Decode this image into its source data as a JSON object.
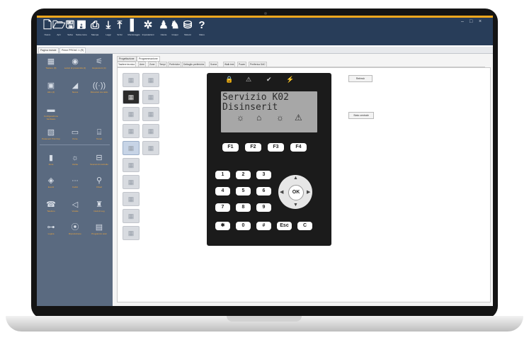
{
  "toolbar": {
    "items": [
      {
        "icon": "new-file-icon",
        "glyph": "🗋",
        "label": "Nuovo"
      },
      {
        "icon": "open-icon",
        "glyph": "🗁",
        "label": "Apri"
      },
      {
        "icon": "save-icon",
        "glyph": "🖫",
        "label": "Salva"
      },
      {
        "icon": "save-as-icon",
        "glyph": "🖪",
        "label": "Salva come"
      },
      {
        "icon": "print-icon",
        "glyph": "⎙",
        "label": "Stampa"
      },
      {
        "icon": "download-icon",
        "glyph": "⤓",
        "label": "Leggi"
      },
      {
        "icon": "upload-icon",
        "glyph": "⤒",
        "label": "Scrivi"
      },
      {
        "icon": "monitoring-icon",
        "glyph": "▌",
        "label": "Monitoraggio"
      },
      {
        "icon": "settings-icon",
        "glyph": "✲",
        "label": "Impostazioni"
      },
      {
        "icon": "user-icon",
        "glyph": "♟",
        "label": "Utente"
      },
      {
        "icon": "group-icon",
        "glyph": "♞",
        "label": "Gruppi"
      },
      {
        "icon": "database-icon",
        "glyph": "⛁",
        "label": "Sistemi"
      },
      {
        "icon": "help-icon",
        "glyph": "?",
        "label": "Manu"
      }
    ],
    "window_controls": [
      "–",
      "□",
      "×"
    ]
  },
  "doc_tabs": [
    "Pagina iniziale",
    "Prime PROAC 1 (R)"
  ],
  "sidebar": {
    "items": [
      {
        "icon": "keypad-icon",
        "glyph": "▦",
        "label": "Tastiere (8)"
      },
      {
        "icon": "wireless-icon",
        "glyph": "◉",
        "label": "Lettori di prossimità (4)"
      },
      {
        "icon": "expander-icon",
        "glyph": "⚟",
        "label": "Espansioni (4)"
      },
      {
        "icon": "power-icon",
        "glyph": "▣",
        "label": "Alim (4)"
      },
      {
        "icon": "signal-icon",
        "glyph": "◢",
        "label": "Nexus"
      },
      {
        "icon": "wireless-receiver-icon",
        "glyph": "((·))",
        "label": "Ricevitori via radio"
      },
      {
        "icon": "config-icon",
        "glyph": "▬",
        "label": "Configurazione hardware"
      },
      {
        "icon": "programming-icon",
        "glyph": "▧",
        "label": "Parametri Prim/Imp"
      },
      {
        "icon": "terminal-icon",
        "glyph": "▭",
        "label": "Porte"
      },
      {
        "icon": "timer-icon",
        "glyph": "⌸",
        "label": "Tempi"
      },
      {
        "icon": "door-icon",
        "glyph": "▮",
        "label": "Zone"
      },
      {
        "icon": "light-icon",
        "glyph": "☼",
        "label": "Uscite"
      },
      {
        "icon": "scenario-icon",
        "glyph": "⊟",
        "label": "Scenari di controllo"
      },
      {
        "icon": "event-icon",
        "glyph": "◈",
        "label": "Eventi"
      },
      {
        "icon": "code-icon",
        "glyph": "∙∙∙",
        "label": "Codici"
      },
      {
        "icon": "key-icon",
        "glyph": "⚲",
        "label": "Chiavi"
      },
      {
        "icon": "phone-icon",
        "glyph": "☎",
        "label": "Telefono"
      },
      {
        "icon": "voice-icon",
        "glyph": "◁",
        "label": "Vocale"
      },
      {
        "icon": "shield-icon",
        "glyph": "♜",
        "label": "Nodi di Log"
      },
      {
        "icon": "logic-icon",
        "glyph": "⊶",
        "label": "Logica"
      },
      {
        "icon": "play-icon",
        "glyph": "⦿",
        "label": "Riproduzione"
      },
      {
        "icon": "calendar-icon",
        "glyph": "▤",
        "label": "Programmi orari"
      }
    ]
  },
  "main": {
    "sub_tabs": [
      "Progettazione",
      "Programmazione"
    ],
    "config_tabs": [
      "Tastiere tecnica",
      "Aree",
      "Zone",
      "Tempi",
      "Preferiche",
      "Dettaglio periferiche",
      "Scene",
      "Walk test",
      "Power",
      "Periferica DAC"
    ],
    "buttons": {
      "refresh": "Refresh",
      "stato_centrale": "Stato centrale"
    }
  },
  "keypad": {
    "status_icons": [
      "🔒",
      "⚠",
      "✔",
      "⚡"
    ],
    "display_lines": [
      "Servizio K02",
      "Disinserit"
    ],
    "display_icons": [
      "☼",
      "⌂",
      "☼",
      "⚠"
    ],
    "function_keys": [
      "F1",
      "F2",
      "F3",
      "F4"
    ],
    "number_keys": [
      "1",
      "2",
      "3",
      "4",
      "5",
      "6",
      "7",
      "8",
      "9",
      "✱",
      "0",
      "#",
      "Esc",
      "C"
    ],
    "nav_ok": "OK"
  }
}
